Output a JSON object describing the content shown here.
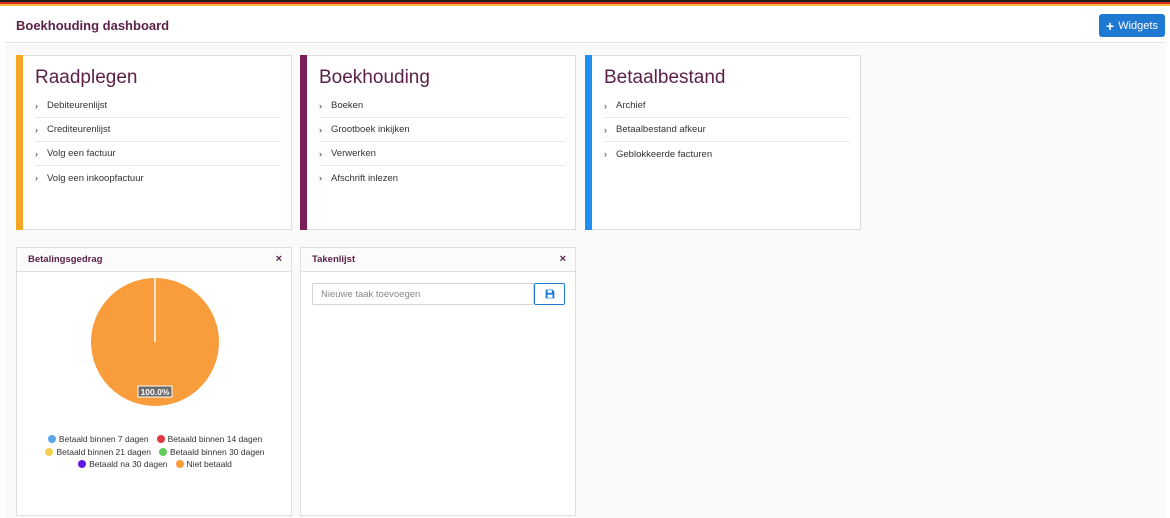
{
  "header": {
    "title": "Boekhouding dashboard",
    "widgets_label": "Widgets"
  },
  "tiles": [
    {
      "title": "Raadplegen",
      "accent": "#f6a623",
      "items": [
        "Debiteurenlijst",
        "Crediteurenlijst",
        "Volg een factuur",
        "Volg een inkoopfactuur"
      ]
    },
    {
      "title": "Boekhouding",
      "accent": "#7a1f57",
      "items": [
        "Boeken",
        "Grootboek inkijken",
        "Verwerken",
        "Afschrift inlezen"
      ]
    },
    {
      "title": "Betaalbestand",
      "accent": "#1f8ff0",
      "items": [
        "Archief",
        "Betaalbestand afkeur",
        "Geblokkeerde facturen"
      ]
    }
  ],
  "betalingsgedrag": {
    "title": "Betalingsgedrag",
    "close": "×"
  },
  "takenlijst": {
    "title": "Takenlijst",
    "close": "×",
    "input_placeholder": "Nieuwe taak toevoegen",
    "input_value": ""
  },
  "chart_data": {
    "type": "pie",
    "title": "",
    "categories": [
      "Betaald binnen 7 dagen",
      "Betaald binnen 14 dagen",
      "Betaald binnen 21 dagen",
      "Betaald binnen 30 dagen",
      "Betaald na 30 dagen",
      "Niet betaald"
    ],
    "values": [
      0,
      0,
      0,
      0,
      0,
      100
    ],
    "colors": [
      "#5aa7f0",
      "#e0383e",
      "#f6d04d",
      "#5fce5a",
      "#6417e8",
      "#f99c3b"
    ],
    "data_labels": [
      "",
      "",
      "",
      "",
      "",
      "100.0%"
    ],
    "legend_position": "bottom"
  },
  "icons": {
    "widgets": "plus-icon",
    "list_item": "chevron-right-icon",
    "save": "floppy-disk-icon",
    "close": "close-icon"
  }
}
